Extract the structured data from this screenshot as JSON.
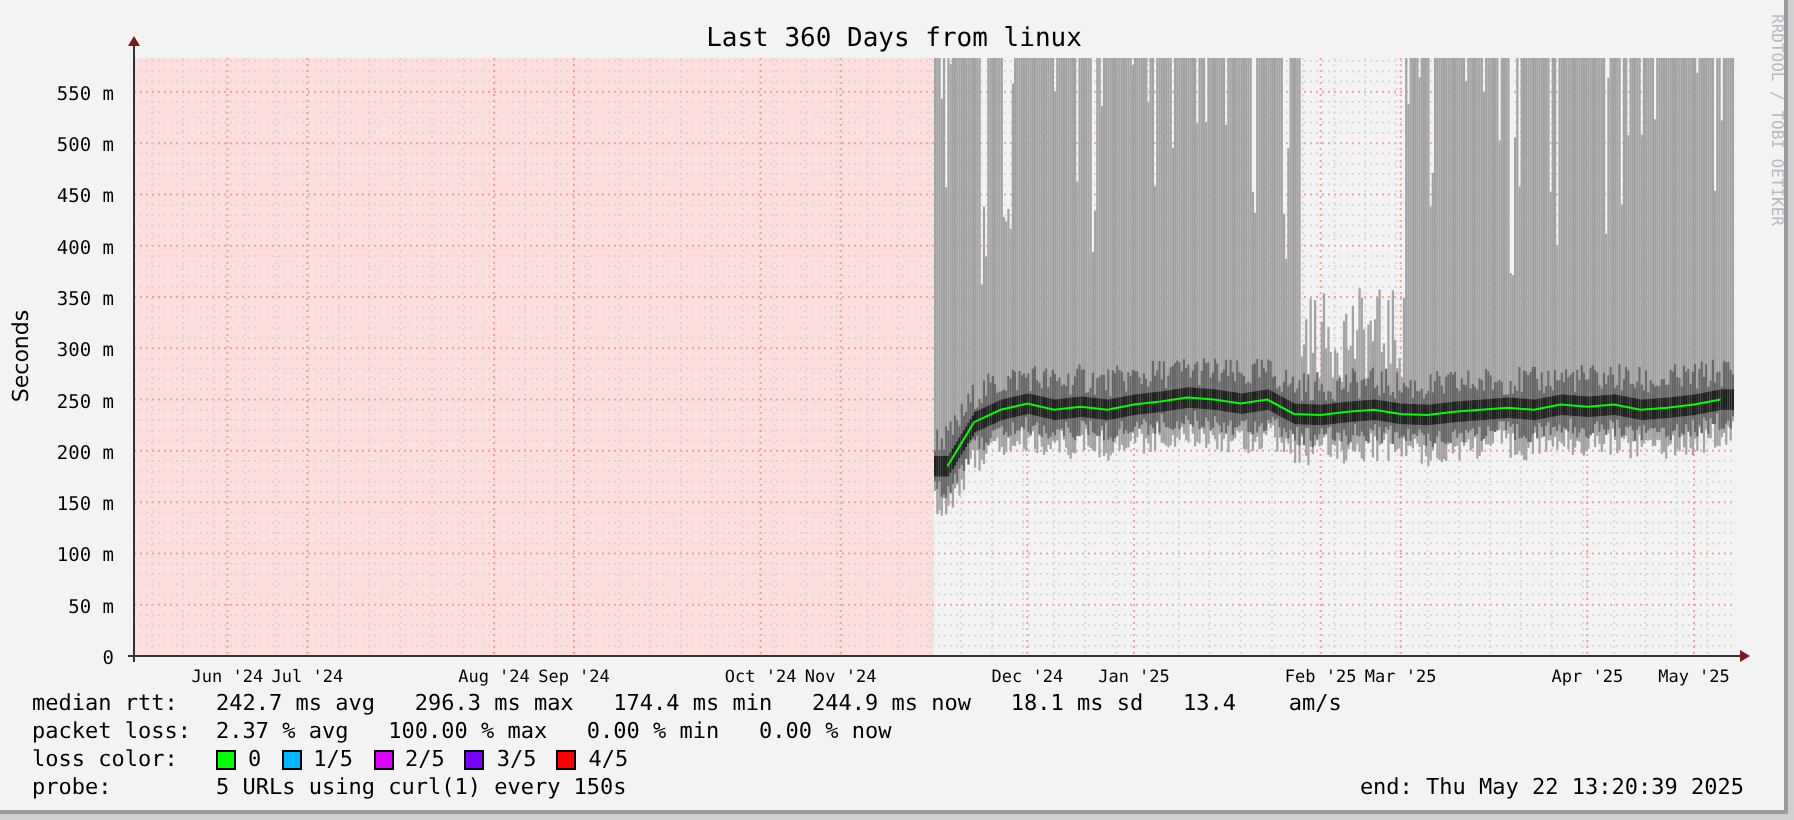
{
  "title": "Last 360 Days from linux",
  "watermark_side": "RRDTOOL / TOBI OETIKER",
  "chart_data": {
    "type": "line",
    "grid": true,
    "ylabel": "Seconds",
    "ylim": [
      0,
      583
    ],
    "yticks": [
      {
        "value": 0,
        "label": "0"
      },
      {
        "value": 50,
        "label": "50 m"
      },
      {
        "value": 100,
        "label": "100 m"
      },
      {
        "value": 150,
        "label": "150 m"
      },
      {
        "value": 200,
        "label": "200 m"
      },
      {
        "value": 250,
        "label": "250 m"
      },
      {
        "value": 300,
        "label": "300 m"
      },
      {
        "value": 350,
        "label": "350 m"
      },
      {
        "value": 400,
        "label": "400 m"
      },
      {
        "value": 450,
        "label": "450 m"
      },
      {
        "value": 500,
        "label": "500 m"
      },
      {
        "value": 550,
        "label": "550 m"
      }
    ],
    "categories": [
      null,
      null,
      null,
      "Jun '24",
      null,
      null,
      "Jul '24",
      null,
      null,
      null,
      null,
      null,
      null,
      "Aug '24",
      null,
      null,
      "Sep '24",
      null,
      null,
      null,
      null,
      null,
      null,
      "Oct '24",
      null,
      null,
      "Nov '24",
      null,
      null,
      null,
      null,
      null,
      null,
      "Dec '24",
      null,
      null,
      null,
      "Jan '25",
      null,
      null,
      null,
      null,
      null,
      null,
      "Feb '25",
      null,
      null,
      "Mar '25",
      null,
      null,
      null,
      null,
      null,
      null,
      "Apr '25",
      null,
      null,
      null,
      "May '25",
      null
    ],
    "series": [
      {
        "name": "median rtt:",
        "color": "#00ff00",
        "values": [
          null,
          null,
          null,
          null,
          null,
          null,
          null,
          null,
          null,
          null,
          null,
          null,
          null,
          null,
          null,
          null,
          null,
          null,
          null,
          null,
          null,
          null,
          null,
          null,
          null,
          null,
          null,
          null,
          null,
          null,
          185,
          228,
          240,
          246,
          240,
          243,
          240,
          245,
          248,
          252,
          250,
          246,
          250,
          236,
          235,
          238,
          240,
          236,
          235,
          238,
          240,
          242,
          240,
          245,
          243,
          245,
          240,
          242,
          245,
          250
        ]
      }
    ]
  },
  "legend": [
    {
      "kind": "series",
      "value": "242.7 ms avg   296.3 ms max   174.4 ms min   244.9 ms now   18.1 ms sd   13.4    am/s"
    },
    {
      "kind": "text",
      "label": "packet loss:",
      "value": "2.37 % avg   100.00 % max   0.00 % min   0.00 % now"
    },
    {
      "kind": "colors",
      "label": "loss color:",
      "items": [
        {
          "label": "0",
          "color": "#00ff00"
        },
        {
          "label": "1/5",
          "color": "#00b8ff"
        },
        {
          "label": "2/5",
          "color": "#e000ff"
        },
        {
          "label": "3/5",
          "color": "#7a00ff"
        },
        {
          "label": "4/5",
          "color": "#ff0000"
        }
      ]
    },
    {
      "kind": "text",
      "label": "probe:",
      "value": "5 URLs using curl(1) every 150s",
      "end": "end: Thu May 22 13:20:39 2025"
    }
  ]
}
